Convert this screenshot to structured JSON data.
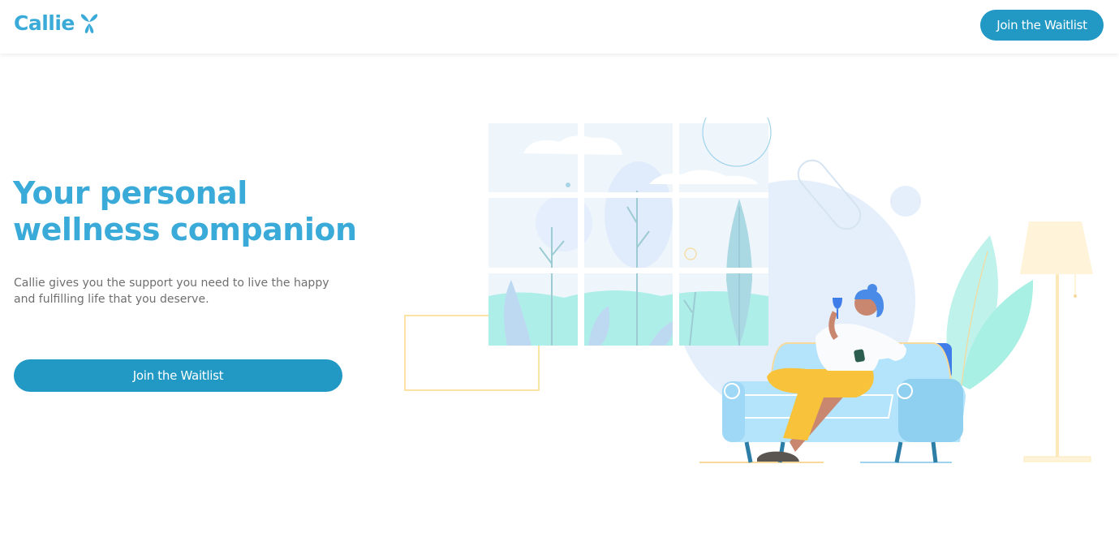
{
  "header": {
    "logo_text": "Callie",
    "logo_icon": "butterfly-icon",
    "cta_label": "Join the Waitlist"
  },
  "hero": {
    "title_line1": "Your personal",
    "title_line2": "wellness companion",
    "description": "Callie gives you the support you need to live the happy and fulfilling life that you deserve.",
    "cta_label": "Join the Waitlist"
  },
  "colors": {
    "brand_blue": "#3aaad8",
    "button_blue": "#2199c4",
    "body_text": "#6f6f6f"
  }
}
